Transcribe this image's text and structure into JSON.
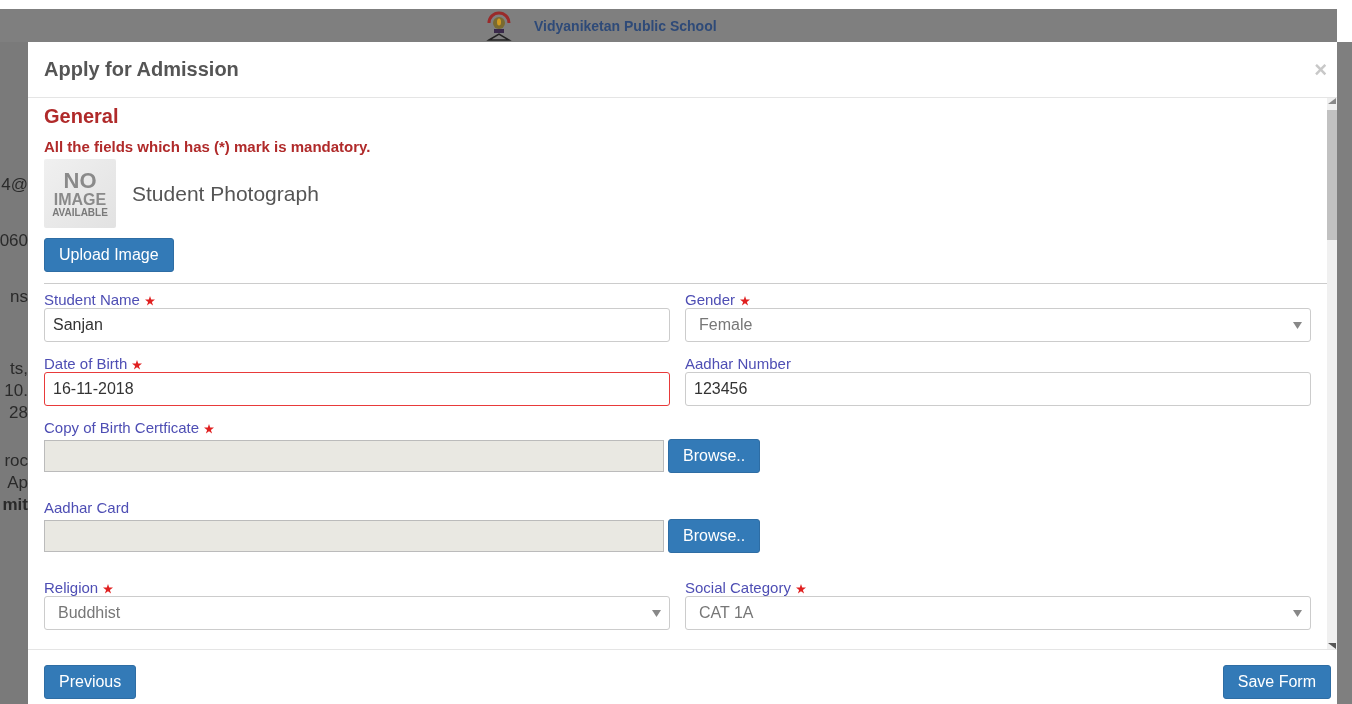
{
  "site_header": {
    "school_name": "Vidyaniketan Public School"
  },
  "background_fragments": [
    "4@",
    "060",
    "ns",
    "ts,",
    "10.",
    "28",
    "roc",
    "Ap",
    "mit"
  ],
  "modal": {
    "title": "Apply for Admission",
    "close": "×"
  },
  "section": {
    "title": "General",
    "note": "All the fields which has (*) mark is mandatory."
  },
  "photo": {
    "placeholder_lines": [
      "NO",
      "IMAGE",
      "AVAILABLE"
    ],
    "label": "Student Photograph",
    "upload_button": "Upload Image"
  },
  "fields": [
    {
      "kind": "text",
      "label": "Student Name",
      "required": true,
      "value": "Sanjan",
      "invalid": false
    },
    {
      "kind": "select",
      "label": "Gender",
      "required": true,
      "value": "Female",
      "invalid": false
    },
    {
      "kind": "text",
      "label": "Date of Birth",
      "required": true,
      "value": "16-11-2018",
      "invalid": true
    },
    {
      "kind": "text",
      "label": "Aadhar Number",
      "required": false,
      "value": "123456",
      "invalid": false
    },
    {
      "kind": "file",
      "label": "Copy of Birth Certficate",
      "required": true,
      "button": "Browse..",
      "invalid": false
    },
    {
      "kind": "file",
      "label": "Aadhar Card",
      "required": false,
      "button": "Browse..",
      "invalid": false
    },
    {
      "kind": "select",
      "label": "Religion",
      "required": true,
      "value": "Buddhist",
      "invalid": false
    },
    {
      "kind": "select",
      "label": "Social Category",
      "required": true,
      "value": "CAT 1A",
      "invalid": false
    }
  ],
  "footer": {
    "previous_button": "Previous",
    "save_button": "Save Form"
  }
}
